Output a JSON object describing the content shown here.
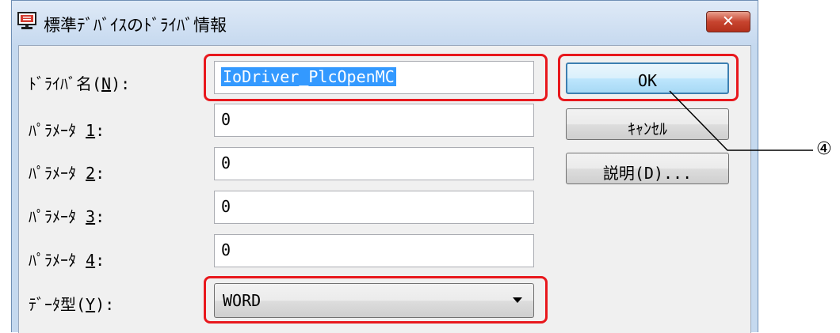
{
  "window": {
    "title": "標準ﾃﾞﾊﾞｲｽのﾄﾞﾗｲﾊﾞ情報",
    "close_label": "✕"
  },
  "form": {
    "driver_name": {
      "label_prefix": "ﾄﾞﾗｲﾊﾞ名(",
      "mnemonic": "N",
      "label_suffix": "):",
      "value": "IoDriver_PlcOpenMC"
    },
    "param1": {
      "label_prefix": "ﾊﾟﾗﾒｰﾀ ",
      "mnemonic": "1",
      "label_suffix": ":",
      "value": "0"
    },
    "param2": {
      "label_prefix": "ﾊﾟﾗﾒｰﾀ ",
      "mnemonic": "2",
      "label_suffix": ":",
      "value": "0"
    },
    "param3": {
      "label_prefix": "ﾊﾟﾗﾒｰﾀ ",
      "mnemonic": "3",
      "label_suffix": ":",
      "value": "0"
    },
    "param4": {
      "label_prefix": "ﾊﾟﾗﾒｰﾀ ",
      "mnemonic": "4",
      "label_suffix": ":",
      "value": "0"
    },
    "data_type": {
      "label_prefix": "ﾃﾞｰﾀ型(",
      "mnemonic": "Y",
      "label_suffix": "):",
      "value": "WORD"
    }
  },
  "buttons": {
    "ok": "OK",
    "cancel": "ｷｬﾝｾﾙ",
    "description": "説明(D)..."
  },
  "annotation": {
    "callout_number": "④",
    "highlight_color": "#e8181d"
  },
  "colors": {
    "selection": "#3399ff",
    "dialog_background": "#f0f0f0",
    "title_bar": "#c6d9ef",
    "close_button": "#c7442f"
  }
}
